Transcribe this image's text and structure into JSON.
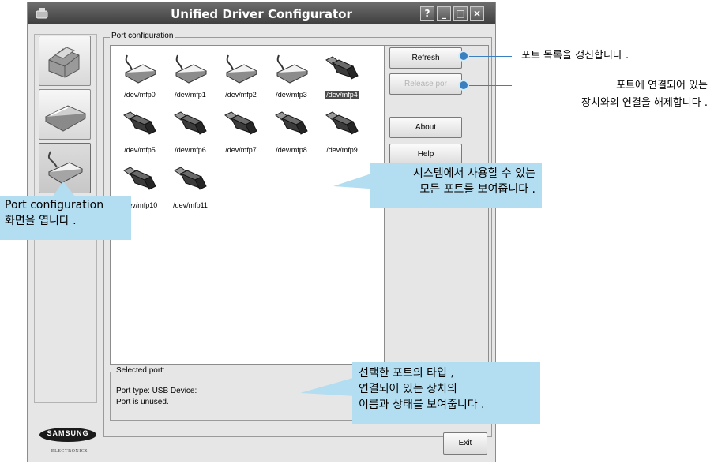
{
  "window": {
    "title": "Unified Driver Configurator"
  },
  "titlebar_buttons": [
    "?",
    "_",
    "□",
    "×"
  ],
  "groups": {
    "port_configuration": "Port configuration",
    "selected_port": "Selected port:"
  },
  "ports": [
    {
      "label": "/dev/mfp0",
      "type": "parallel",
      "selected": false
    },
    {
      "label": "/dev/mfp1",
      "type": "parallel",
      "selected": false
    },
    {
      "label": "/dev/mfp2",
      "type": "parallel",
      "selected": false
    },
    {
      "label": "/dev/mfp3",
      "type": "parallel",
      "selected": false
    },
    {
      "label": "/dev/mfp4",
      "type": "usb",
      "selected": true
    },
    {
      "label": "/dev/mfp5",
      "type": "usb",
      "selected": false
    },
    {
      "label": "/dev/mfp6",
      "type": "usb",
      "selected": false
    },
    {
      "label": "/dev/mfp7",
      "type": "usb",
      "selected": false
    },
    {
      "label": "/dev/mfp8",
      "type": "usb",
      "selected": false
    },
    {
      "label": "/dev/mfp9",
      "type": "usb",
      "selected": false
    },
    {
      "label": "/dev/mfp10",
      "type": "usb",
      "selected": false
    },
    {
      "label": "/dev/mfp11",
      "type": "usb",
      "selected": false
    }
  ],
  "buttons": {
    "refresh": "Refresh",
    "release": "Release por",
    "about": "About",
    "help": "Help",
    "exit": "Exit"
  },
  "selected_port": {
    "type_line": "Port type: USB   Device:",
    "status": "Port is unused."
  },
  "brand": {
    "name": "SAMSUNG",
    "sub": "ELECTRONICS"
  },
  "annotations": {
    "refresh": "포트 목록을 갱신합니다 .",
    "release_line1": "포트에 연결되어 있는",
    "release_line2": "장치와의 연결을 해제합니다 .",
    "ports_line1": "시스템에서 사용할 수 있는",
    "ports_line2": "모든 포트를 보여줍니다 .",
    "portcfg_line1": "Port configuration",
    "portcfg_line2": "화면을 엽니다 .",
    "selected_line1": "선택한 포트의 타입 ,",
    "selected_line2": "연결되어 있는 장치의",
    "selected_line3": "이름과 상태를 보여줍니다 ."
  },
  "colors": {
    "callout": "#b3ddf0",
    "accent": "#3a7fbf",
    "titlebar": "#4a4a4a"
  }
}
